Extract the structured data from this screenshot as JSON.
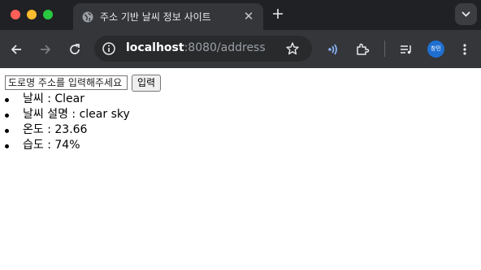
{
  "browser": {
    "tab": {
      "title": "주소 기반 날씨 정보 사이트"
    },
    "address_bar": {
      "url_host": "localhost",
      "url_rest": ":8080/address"
    },
    "profile": {
      "initials": "창민"
    },
    "colors": {
      "chrome_bg": "#202124",
      "toolbar_bg": "#35363a",
      "profile_blue": "#1f6fd1"
    },
    "icons": [
      "close-icon",
      "minimize-icon",
      "maximize-icon",
      "globe-icon",
      "tab-close-icon",
      "new-tab-icon",
      "tab-search-icon",
      "back-icon",
      "forward-icon",
      "reload-icon",
      "site-info-icon",
      "bookmark-star-icon",
      "cast-icon",
      "extensions-icon",
      "media-control-icon",
      "avatar",
      "menu-icon"
    ]
  },
  "page": {
    "form": {
      "placeholder": "도로명 주소를 입력해주세요",
      "submit_label": "입력"
    },
    "weather_items": [
      {
        "text": "날씨 : Clear"
      },
      {
        "text": "날씨 설명 : clear sky"
      },
      {
        "text": "온도 : 23.66"
      },
      {
        "text": "습도 : 74%"
      }
    ]
  }
}
